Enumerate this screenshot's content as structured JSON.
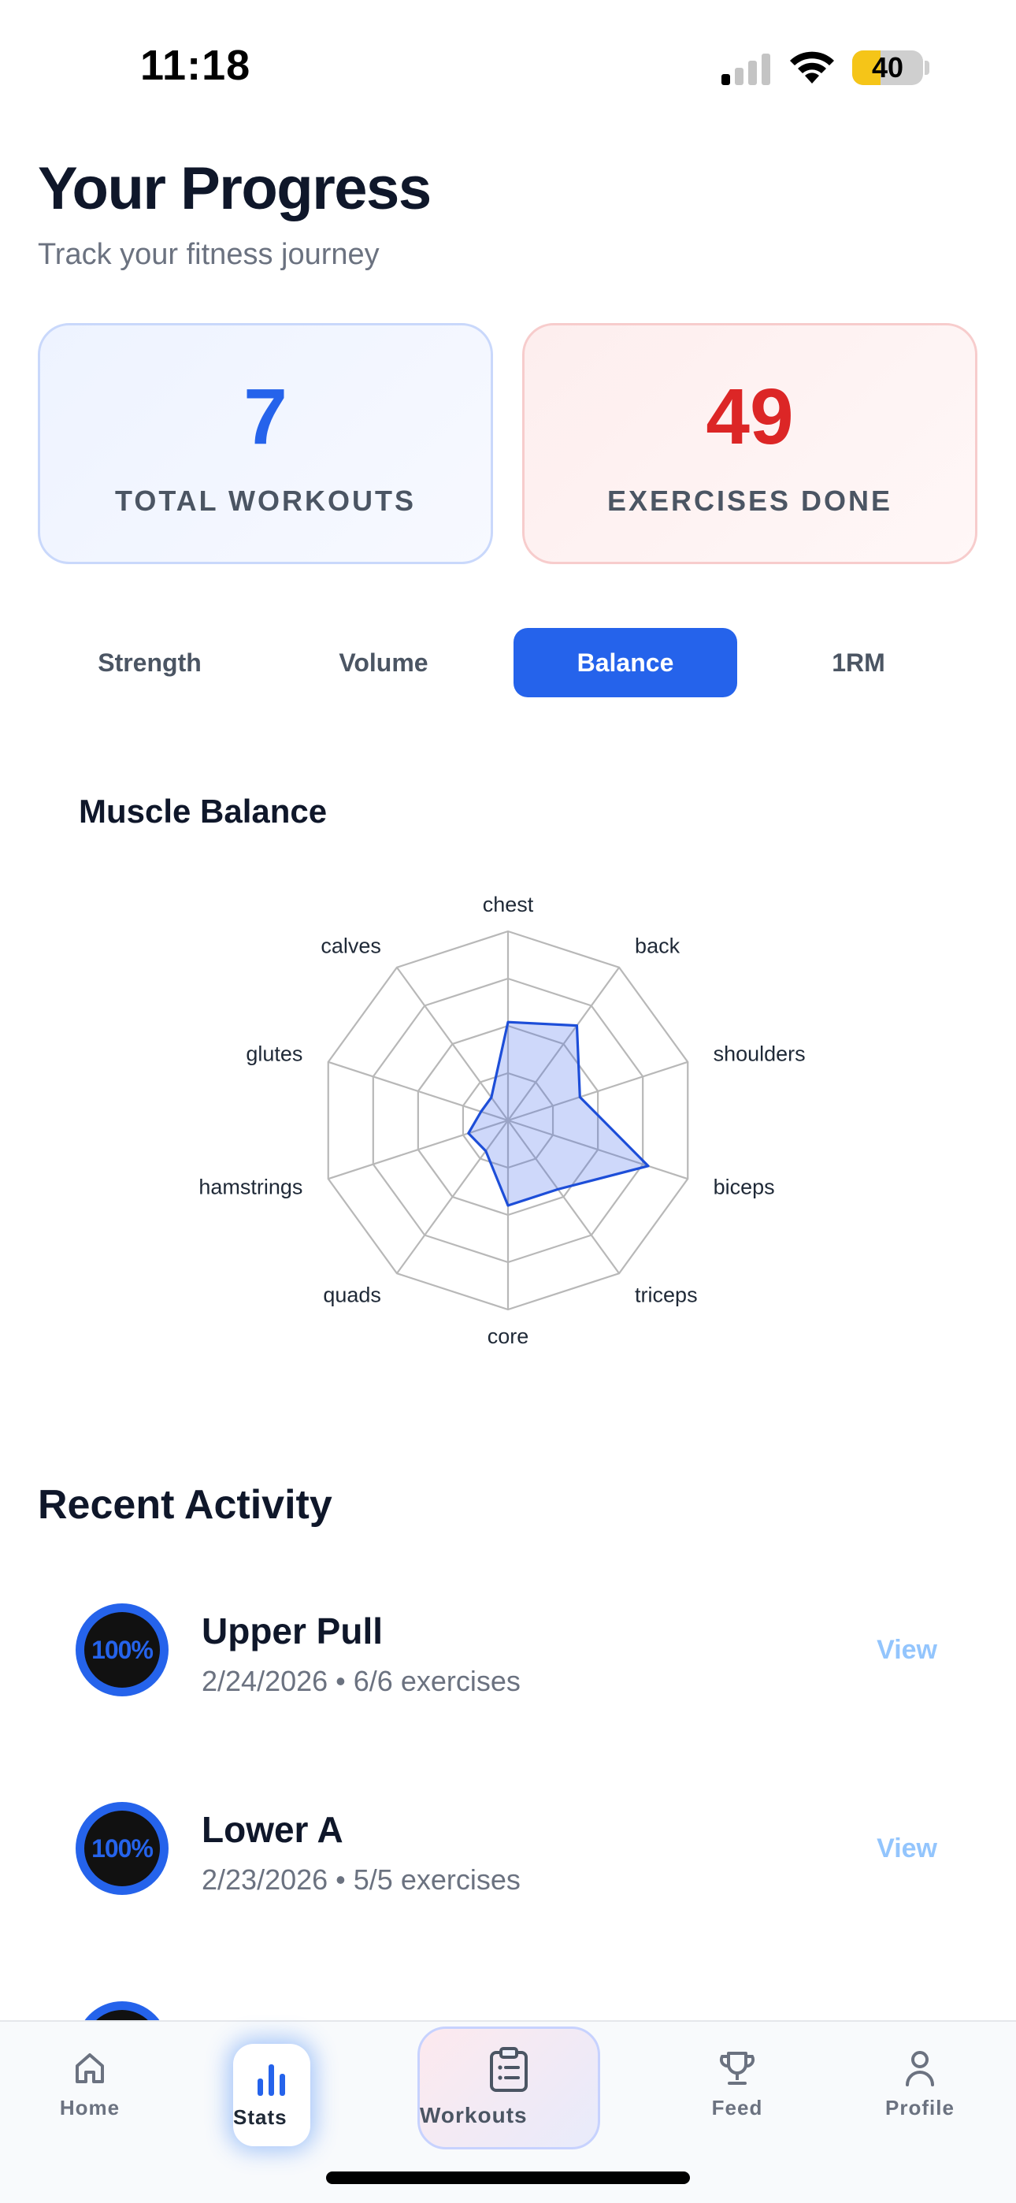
{
  "status_bar": {
    "time": "11:18",
    "battery": "40",
    "battery_level": 0.4
  },
  "header": {
    "title": "Your Progress",
    "subtitle": "Track your fitness journey"
  },
  "stats": [
    {
      "value": "7",
      "label": "TOTAL WORKOUTS",
      "color": "#2563eb"
    },
    {
      "value": "49",
      "label": "EXERCISES DONE",
      "color": "#dc2626"
    }
  ],
  "tabs": [
    {
      "label": "Strength",
      "active": false
    },
    {
      "label": "Volume",
      "active": false
    },
    {
      "label": "Balance",
      "active": true
    },
    {
      "label": "1RM",
      "active": false
    }
  ],
  "chart": {
    "title": "Muscle Balance"
  },
  "chart_data": {
    "type": "radar",
    "axes": [
      "chest",
      "back",
      "shoulders",
      "biceps",
      "triceps",
      "core",
      "quads",
      "hamstrings",
      "glutes",
      "calves"
    ],
    "values": [
      0.52,
      0.62,
      0.4,
      0.78,
      0.45,
      0.45,
      0.2,
      0.22,
      0.15,
      0.15
    ],
    "rings": 4,
    "max": 1,
    "series_color": "#1d4ed8"
  },
  "recent": {
    "title": "Recent Activity",
    "items": [
      {
        "name": "Upper Pull",
        "date": "2/24/2026",
        "detail": "6/6 exercises",
        "progress": "100%",
        "action": "View"
      },
      {
        "name": "Lower A",
        "date": "2/23/2026",
        "detail": "5/5 exercises",
        "progress": "100%",
        "action": "View"
      }
    ]
  },
  "nav": {
    "home": "Home",
    "stats": "Stats",
    "workouts": "Workouts",
    "feed": "Feed",
    "profile": "Profile"
  }
}
